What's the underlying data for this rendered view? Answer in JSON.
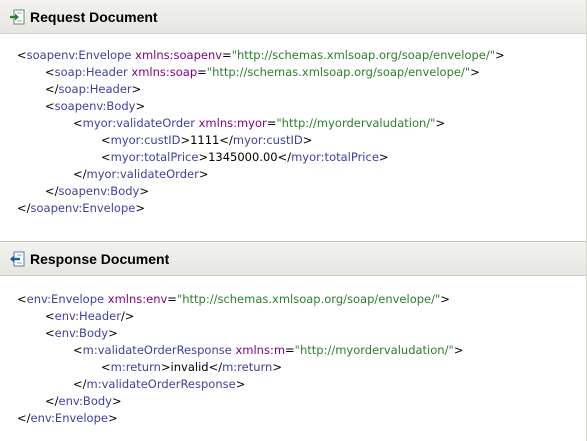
{
  "request": {
    "title": "Request Document",
    "icon": "request-arrow-icon",
    "lines": [
      {
        "indent": 0,
        "parts": [
          [
            "p",
            "<"
          ],
          [
            "t",
            "soapenv:Envelope"
          ],
          [
            "p",
            " "
          ],
          [
            "a",
            "xmlns:soapenv"
          ],
          [
            "p",
            "="
          ],
          [
            "v",
            "\"http://schemas.xmlsoap.org/soap/envelope/\""
          ],
          [
            "p",
            ">"
          ]
        ]
      },
      {
        "indent": 1,
        "parts": [
          [
            "p",
            "<"
          ],
          [
            "t",
            "soap:Header"
          ],
          [
            "p",
            " "
          ],
          [
            "a",
            "xmlns:soap"
          ],
          [
            "p",
            "="
          ],
          [
            "v",
            "\"http://schemas.xmlsoap.org/soap/envelope/\""
          ],
          [
            "p",
            ">"
          ]
        ]
      },
      {
        "indent": 1,
        "parts": [
          [
            "p",
            "</"
          ],
          [
            "t",
            "soap:Header"
          ],
          [
            "p",
            ">"
          ]
        ]
      },
      {
        "indent": 1,
        "parts": [
          [
            "p",
            "<"
          ],
          [
            "t",
            "soapenv:Body"
          ],
          [
            "p",
            ">"
          ]
        ]
      },
      {
        "indent": 2,
        "parts": [
          [
            "p",
            "<"
          ],
          [
            "t",
            "myor:validateOrder"
          ],
          [
            "p",
            " "
          ],
          [
            "a",
            "xmlns:myor"
          ],
          [
            "p",
            "="
          ],
          [
            "v",
            "\"http://myordervaludation/\""
          ],
          [
            "p",
            ">"
          ]
        ]
      },
      {
        "indent": 3,
        "parts": [
          [
            "p",
            "<"
          ],
          [
            "t",
            "myor:custID"
          ],
          [
            "p",
            ">"
          ],
          [
            "x",
            "1111"
          ],
          [
            "p",
            "</"
          ],
          [
            "t",
            "myor:custID"
          ],
          [
            "p",
            ">"
          ]
        ]
      },
      {
        "indent": 3,
        "parts": [
          [
            "p",
            "<"
          ],
          [
            "t",
            "myor:totalPrice"
          ],
          [
            "p",
            ">"
          ],
          [
            "x",
            "1345000.00"
          ],
          [
            "p",
            "</"
          ],
          [
            "t",
            "myor:totalPrice"
          ],
          [
            "p",
            ">"
          ]
        ]
      },
      {
        "indent": 2,
        "parts": [
          [
            "p",
            "</"
          ],
          [
            "t",
            "myor:validateOrder"
          ],
          [
            "p",
            ">"
          ]
        ]
      },
      {
        "indent": 1,
        "parts": [
          [
            "p",
            "</"
          ],
          [
            "t",
            "soapenv:Body"
          ],
          [
            "p",
            ">"
          ]
        ]
      },
      {
        "indent": 0,
        "parts": [
          [
            "p",
            "</"
          ],
          [
            "t",
            "soapenv:Envelope"
          ],
          [
            "p",
            ">"
          ]
        ]
      }
    ]
  },
  "response": {
    "title": "Response Document",
    "icon": "response-arrow-icon",
    "lines": [
      {
        "indent": 0,
        "parts": [
          [
            "p",
            "<"
          ],
          [
            "t",
            "env:Envelope"
          ],
          [
            "p",
            " "
          ],
          [
            "a",
            "xmlns:env"
          ],
          [
            "p",
            "="
          ],
          [
            "v",
            "\"http://schemas.xmlsoap.org/soap/envelope/\""
          ],
          [
            "p",
            ">"
          ]
        ]
      },
      {
        "indent": 1,
        "parts": [
          [
            "p",
            "<"
          ],
          [
            "t",
            "env:Header"
          ],
          [
            "p",
            "/>"
          ]
        ]
      },
      {
        "indent": 1,
        "parts": [
          [
            "p",
            "<"
          ],
          [
            "t",
            "env:Body"
          ],
          [
            "p",
            ">"
          ]
        ]
      },
      {
        "indent": 2,
        "parts": [
          [
            "p",
            "<"
          ],
          [
            "t",
            "m:validateOrderResponse"
          ],
          [
            "p",
            " "
          ],
          [
            "a",
            "xmlns:m"
          ],
          [
            "p",
            "="
          ],
          [
            "v",
            "\"http://myordervaludation/\""
          ],
          [
            "p",
            ">"
          ]
        ]
      },
      {
        "indent": 3,
        "parts": [
          [
            "p",
            "<"
          ],
          [
            "t",
            "m:return"
          ],
          [
            "p",
            ">"
          ],
          [
            "x",
            "invalid"
          ],
          [
            "p",
            "</"
          ],
          [
            "t",
            "m:return"
          ],
          [
            "p",
            ">"
          ]
        ]
      },
      {
        "indent": 2,
        "parts": [
          [
            "p",
            "</"
          ],
          [
            "t",
            "m:validateOrderResponse"
          ],
          [
            "p",
            ">"
          ]
        ]
      },
      {
        "indent": 1,
        "parts": [
          [
            "p",
            "</"
          ],
          [
            "t",
            "env:Body"
          ],
          [
            "p",
            ">"
          ]
        ]
      },
      {
        "indent": 0,
        "parts": [
          [
            "p",
            "</"
          ],
          [
            "t",
            "env:Envelope"
          ],
          [
            "p",
            ">"
          ]
        ]
      }
    ]
  },
  "colors": {
    "tag": "#3f3f9f",
    "attribute": "#7f007f",
    "value": "#2a7f2a",
    "text": "#000000",
    "icon": "#2e7d32",
    "icon_response": "#1e5aa8"
  }
}
